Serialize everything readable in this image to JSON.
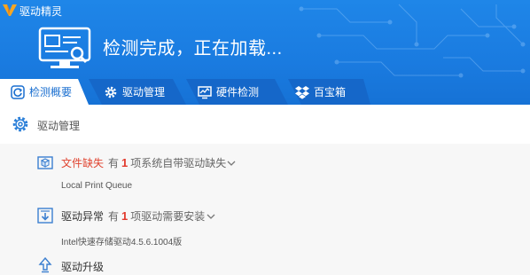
{
  "window": {
    "title": "驱动精灵",
    "brand_color": "#1a7be0",
    "logo": "driver-genius-logo"
  },
  "status": {
    "text": "检测完成，正在加载..."
  },
  "tabs": [
    {
      "label": "检测概要",
      "icon": "refresh-icon",
      "active": true
    },
    {
      "label": "驱动管理",
      "icon": "gear-icon",
      "active": false
    },
    {
      "label": "硬件检测",
      "icon": "monitor-chart-icon",
      "active": false
    },
    {
      "label": "百宝箱",
      "icon": "dropbox-icon",
      "active": false
    }
  ],
  "section": {
    "label": "驱动管理",
    "icon": "gear-outline-icon"
  },
  "items": [
    {
      "title": "文件缺失",
      "title_color": "#e0432f",
      "prefix": "有",
      "count": "1",
      "suffix": "项系统自带驱动缺失",
      "detail": "Local Print Queue",
      "icon": "file-warning-icon"
    },
    {
      "title": "驱动异常",
      "title_color": "#333333",
      "prefix": "有",
      "count": "1",
      "suffix": "项驱动需要安装",
      "detail": "Intel快速存储驱动4.5.6.1004版",
      "icon": "install-icon"
    },
    {
      "title": "驱动升级",
      "title_color": "#333333",
      "icon": "upgrade-arrow-icon"
    }
  ]
}
